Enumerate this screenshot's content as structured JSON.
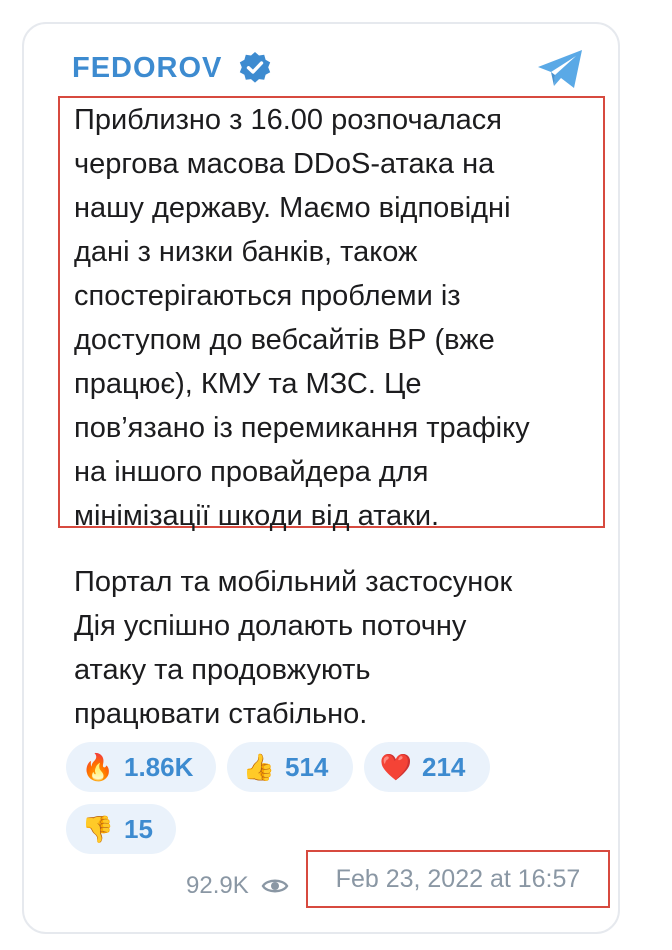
{
  "channel": {
    "name": "FEDOROV",
    "verified": true,
    "accent_color": "#3d8bd0"
  },
  "post": {
    "paragraph_1": "Приблизно з 16.00 розпочалася\nчергова масова DDoS-атака на\nнашу державу. Маємо відповідні\nдані з низки банків, також\nспостерігаються проблеми із\nдоступом до вебсайтів ВР (вже\nпрацює), КМУ та МЗС. Це\nпов’язано із перемикання трафіку\nна іншого провайдера для\nмінімізації шкоди від атаки.",
    "paragraph_2": "Портал та мобільний застосунок\nДія успішно долають поточну\nатаку та продовжують\nпрацювати стабільно."
  },
  "reactions": [
    {
      "icon": "fire-emoji",
      "emoji": "🔥",
      "count": "1.86K"
    },
    {
      "icon": "thumbs-up-emoji",
      "emoji": "👍",
      "count": "514"
    },
    {
      "icon": "heart-emoji",
      "emoji": "❤️",
      "count": "214"
    },
    {
      "icon": "thumbs-down-emoji",
      "emoji": "👎",
      "count": "15"
    }
  ],
  "footer": {
    "views": "92.9K",
    "date": "Feb 23, 2022 at 16:57"
  },
  "colors": {
    "highlight_border": "#d74a3f",
    "reaction_bg": "#eaf2fb",
    "meta_text": "#8a97a4",
    "telegram_blue": "#5aa9e6"
  }
}
